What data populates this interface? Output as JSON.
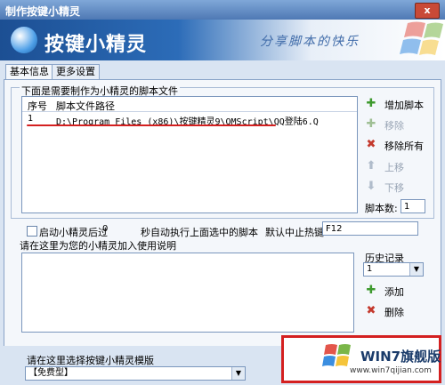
{
  "window": {
    "title": "制作按键小精灵",
    "close_label": "x"
  },
  "banner": {
    "app_name": "按键小精灵",
    "slogan": "分享脚本的快乐"
  },
  "tabs": [
    {
      "label": "基本信息"
    },
    {
      "label": "更多设置"
    }
  ],
  "scripts": {
    "section_label": "下面是需要制作为小精灵的脚本文件",
    "columns": [
      "序号",
      "脚本文件路径"
    ],
    "rows": [
      {
        "index": "1",
        "path": "D:\\Program Files (x86)\\按键精灵9\\QMScript\\QQ登陆6.Q"
      }
    ],
    "count_label": "脚本数:",
    "count_value": "1"
  },
  "side_buttons": [
    {
      "label": "增加脚本",
      "icon": "plus-icon"
    },
    {
      "label": "移除",
      "icon": "remove-icon"
    },
    {
      "label": "移除所有",
      "icon": "remove-all-icon"
    },
    {
      "label": "上移",
      "icon": "arrow-up-icon"
    },
    {
      "label": "下移",
      "icon": "arrow-down-icon"
    }
  ],
  "autorun": {
    "prefix": "启动小精灵后过",
    "seconds": "0",
    "suffix": "秒自动执行上面选中的脚本",
    "hotkey_label": "默认中止热键",
    "hotkey_value": "F12"
  },
  "notes": {
    "label": "请在这里为您的小精灵加入使用说明",
    "value": ""
  },
  "history": {
    "label": "历史记录",
    "selected": "1",
    "add_label": "添加",
    "delete_label": "删除"
  },
  "template": {
    "label": "请在这里选择按键小精灵模版",
    "selected": "【免费型】"
  },
  "watermark": {
    "text": "WIN7旗舰版",
    "site": "www.win7qijian.com"
  },
  "colors": {
    "accent": "#2c6cb8",
    "highlight": "#d42020"
  }
}
